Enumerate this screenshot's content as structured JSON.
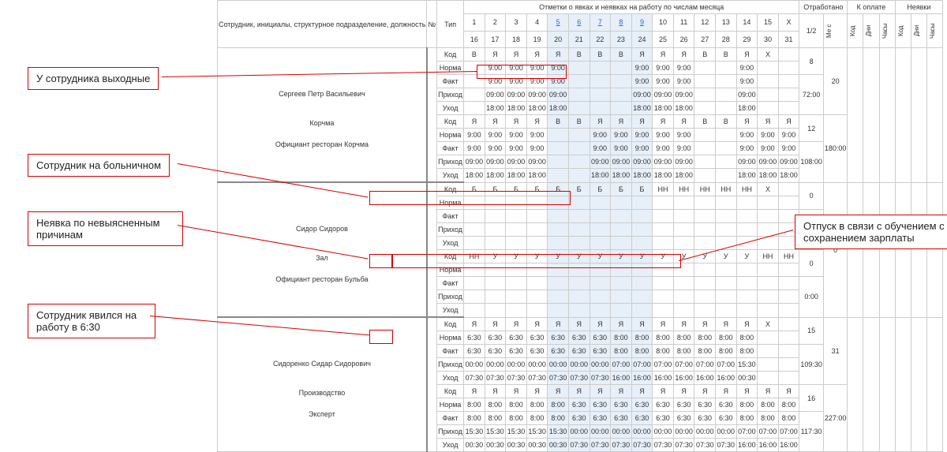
{
  "headers": {
    "employee": "Сотрудник, инициалы, структурное подразделение, должность",
    "num": "№",
    "type": "Тип",
    "marks_title": "Отметки о явках и неявках на работу по числам месяца",
    "worked": "Отработано",
    "to_pay": "К оплате",
    "absence": "Неявки",
    "half": "1/2",
    "mes": "Ме с",
    "kod": "Код",
    "dni": "Дни",
    "chasy": "Часы",
    "days1": [
      "1",
      "2",
      "3",
      "4",
      "5",
      "6",
      "7",
      "8",
      "9",
      "10",
      "11",
      "12",
      "13",
      "14",
      "15",
      "X"
    ],
    "days2": [
      "16",
      "17",
      "18",
      "19",
      "20",
      "21",
      "22",
      "23",
      "24",
      "25",
      "26",
      "27",
      "28",
      "29",
      "30",
      "31"
    ]
  },
  "row_types": {
    "kod": "Код",
    "norma": "Норма",
    "fakt": "Факт",
    "prihod": "Приход",
    "uhod": "Уход"
  },
  "employees": [
    {
      "name": "Сергеев Петр Васильевич",
      "dept": "Корчма",
      "pos": "",
      "top": {
        "kod": [
          "В",
          "Я",
          "Я",
          "Я",
          "Я",
          "В",
          "В",
          "В",
          "Я",
          "Я",
          "Я",
          "В",
          "В",
          "Я",
          "Х",
          ""
        ],
        "norma": [
          "",
          "9:00",
          "9:00",
          "9:00",
          "9:00",
          "",
          "",
          "",
          "9:00",
          "9:00",
          "9:00",
          "",
          "",
          "9:00",
          "",
          ""
        ],
        "fakt": [
          "",
          "9:00",
          "9:00",
          "9:00",
          "9:00",
          "",
          "",
          "",
          "9:00",
          "9:00",
          "9:00",
          "",
          "",
          "9:00",
          "",
          ""
        ],
        "prihod": [
          "",
          "09:00",
          "09:00",
          "09:00",
          "09:00",
          "",
          "",
          "",
          "09:00",
          "09:00",
          "09:00",
          "",
          "",
          "09:00",
          "",
          ""
        ],
        "uhod": [
          "",
          "18:00",
          "18:00",
          "18:00",
          "18:00",
          "",
          "",
          "",
          "18:00",
          "18:00",
          "18:00",
          "",
          "",
          "18:00",
          "",
          ""
        ]
      },
      "half_top": "8",
      "hours_top": "72:00",
      "mes_days": "20"
    },
    {
      "name": "Официант ресторан Корчма",
      "dept": "",
      "pos": "",
      "top": {
        "kod": [
          "Я",
          "Я",
          "Я",
          "Я",
          "В",
          "В",
          "Я",
          "Я",
          "Я",
          "Я",
          "Я",
          "В",
          "В",
          "Я",
          "Я",
          "Я"
        ],
        "norma": [
          "9:00",
          "9:00",
          "9:00",
          "9:00",
          "",
          "",
          "9:00",
          "9:00",
          "9:00",
          "9:00",
          "9:00",
          "",
          "",
          "9:00",
          "9:00",
          "9:00"
        ],
        "fakt": [
          "9:00",
          "9:00",
          "9:00",
          "9:00",
          "",
          "",
          "9:00",
          "9:00",
          "9:00",
          "9:00",
          "9:00",
          "",
          "",
          "9:00",
          "9:00",
          "9:00"
        ],
        "prihod": [
          "09:00",
          "09:00",
          "09:00",
          "09:00",
          "",
          "",
          "09:00",
          "09:00",
          "09:00",
          "09:00",
          "09:00",
          "",
          "",
          "09:00",
          "09:00",
          "09:00"
        ],
        "uhod": [
          "18:00",
          "18:00",
          "18:00",
          "18:00",
          "",
          "",
          "18:00",
          "18:00",
          "18:00",
          "18:00",
          "18:00",
          "",
          "",
          "18:00",
          "18:00",
          "18:00"
        ]
      },
      "half_top": "12",
      "hours_top": "108:00",
      "mes_days": "180:00"
    },
    {
      "name": "Сидор Сидоров",
      "dept": "Зал",
      "pos": "Официант ресторан Бульба",
      "top": {
        "kod": [
          "Б",
          "Б",
          "Б",
          "Б",
          "Б",
          "Б",
          "Б",
          "Б",
          "Б",
          "НН",
          "НН",
          "НН",
          "НН",
          "НН",
          "Х",
          ""
        ],
        "norma": [
          "",
          "",
          "",
          "",
          "",
          "",
          "",
          "",
          "",
          "",
          "",
          "",
          "",
          "",
          "",
          ""
        ],
        "fakt": [
          "",
          "",
          "",
          "",
          "",
          "",
          "",
          "",
          "",
          "",
          "",
          "",
          "",
          "",
          "",
          ""
        ],
        "prihod": [
          "",
          "",
          "",
          "",
          "",
          "",
          "",
          "",
          "",
          "",
          "",
          "",
          "",
          "",
          "",
          ""
        ],
        "uhod": [
          "",
          "",
          "",
          "",
          "",
          "",
          "",
          "",
          "",
          "",
          "",
          "",
          "",
          "",
          "",
          ""
        ]
      },
      "bot": {
        "kod": [
          "НН",
          "У",
          "У",
          "У",
          "У",
          "У",
          "У",
          "У",
          "У",
          "У",
          "У",
          "У",
          "У",
          "У",
          "НН",
          "НН"
        ],
        "norma": [
          "",
          "",
          "",
          "",
          "",
          "",
          "",
          "",
          "",
          "",
          "",
          "",
          "",
          "",
          "",
          ""
        ],
        "fakt": [
          "",
          "",
          "",
          "",
          "",
          "",
          "",
          "",
          "",
          "",
          "",
          "",
          "",
          "",
          "",
          ""
        ],
        "prihod": [
          "",
          "",
          "",
          "",
          "",
          "",
          "",
          "",
          "",
          "",
          "",
          "",
          "",
          "",
          "",
          ""
        ],
        "uhod": [
          "",
          "",
          "",
          "",
          "",
          "",
          "",
          "",
          "",
          "",
          "",
          "",
          "",
          "",
          "",
          ""
        ]
      },
      "half_top": "0",
      "half_bot": "0",
      "hours_total": "0:00",
      "mes_days": "0"
    },
    {
      "name": "Сидоренко Сидар Сидорович",
      "dept": "Производство",
      "pos": "Эксперт",
      "top": {
        "kod": [
          "Я",
          "Я",
          "Я",
          "Я",
          "Я",
          "Я",
          "Я",
          "Я",
          "Я",
          "Я",
          "Я",
          "Я",
          "Я",
          "Я",
          "Х",
          ""
        ],
        "norma": [
          "6:30",
          "6:30",
          "6:30",
          "6:30",
          "6:30",
          "6:30",
          "6:30",
          "8:00",
          "8:00",
          "8:00",
          "8:00",
          "8:00",
          "8:00",
          "8:00",
          "",
          ""
        ],
        "fakt": [
          "6:30",
          "6:30",
          "6:30",
          "6:30",
          "6:30",
          "6:30",
          "6:30",
          "8:00",
          "8:00",
          "8:00",
          "8:00",
          "8:00",
          "8:00",
          "8:00",
          "",
          ""
        ],
        "prihod": [
          "00:00",
          "00:00",
          "00:00",
          "00:00",
          "00:00",
          "00:00",
          "00:00",
          "07:00",
          "07:00",
          "07:00",
          "07:00",
          "07:00",
          "07:00",
          "15:30",
          "",
          ""
        ],
        "uhod": [
          "07:30",
          "07:30",
          "07:30",
          "07:30",
          "07:30",
          "07:30",
          "07:30",
          "16:00",
          "16:00",
          "16:00",
          "16:00",
          "16:00",
          "16:00",
          "00:30",
          "",
          ""
        ]
      },
      "bot": {
        "kod": [
          "Я",
          "Я",
          "Я",
          "Я",
          "Я",
          "Я",
          "Я",
          "Я",
          "Я",
          "Я",
          "Я",
          "Я",
          "Я",
          "Я",
          "Я",
          "Я"
        ],
        "norma": [
          "8:00",
          "8:00",
          "8:00",
          "8:00",
          "8:00",
          "6:30",
          "6:30",
          "6:30",
          "6:30",
          "6:30",
          "6:30",
          "6:30",
          "6:30",
          "8:00",
          "8:00",
          "8:00"
        ],
        "fakt": [
          "8:00",
          "8:00",
          "8:00",
          "8:00",
          "8:00",
          "6:30",
          "6:30",
          "6:30",
          "6:30",
          "6:30",
          "6:30",
          "6:30",
          "6:30",
          "8:00",
          "8:00",
          "8:00"
        ],
        "prihod": [
          "15:30",
          "15:30",
          "15:30",
          "15:30",
          "15:30",
          "00:00",
          "00:00",
          "00:00",
          "00:00",
          "00:00",
          "00:00",
          "00:00",
          "00:00",
          "07:00",
          "07:00",
          "07:00"
        ],
        "uhod": [
          "00:30",
          "00:30",
          "00:30",
          "00:30",
          "00:30",
          "07:30",
          "07:30",
          "07:30",
          "07:30",
          "07:30",
          "07:30",
          "07:30",
          "07:30",
          "16:00",
          "16:00",
          "16:00"
        ]
      },
      "half_top": "15",
      "half_bot": "16",
      "hours_top": "109:30",
      "hours_bot": "117:30",
      "mes_days": "31",
      "mes_hours": "227:00"
    }
  ],
  "callouts": {
    "weekend": "У сотрудника выходные",
    "sick": "Сотрудник на больничном",
    "unknown": "Неявка по невыясненным причинам",
    "arrived": "Сотрудник явился на работу в 6:30",
    "study": "Отпуск в связи с обучением с сохранением зарплаты"
  },
  "day_link_cols": [
    4,
    5,
    6,
    7,
    8
  ]
}
